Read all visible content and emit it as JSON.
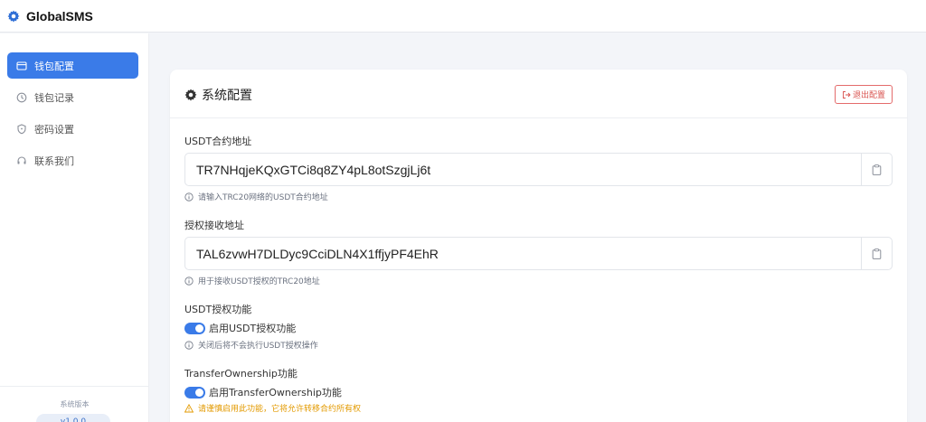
{
  "app": {
    "title": "GlobalSMS",
    "logo_icon": "gear-icon",
    "accent": "#3a7be8"
  },
  "sidebar": {
    "items": [
      {
        "label": "钱包配置",
        "icon": "wallet-icon",
        "active": true
      },
      {
        "label": "钱包记录",
        "icon": "clock-icon",
        "active": false
      },
      {
        "label": "密码设置",
        "icon": "shield-icon",
        "active": false
      },
      {
        "label": "联系我们",
        "icon": "headset-icon",
        "active": false
      }
    ],
    "version_label": "系统版本",
    "version_value": "v1.0.0"
  },
  "card": {
    "title": "系统配置",
    "title_icon": "gear-icon",
    "logout_label": "退出配置",
    "logout_color": "#d9534f",
    "fields": [
      {
        "label": "USDT合约地址",
        "value": "TR7NHqjeKQxGTCi8q8ZY4pL8otSzgjLj6t",
        "hint": "请输入TRC20网络的USDT合约地址"
      },
      {
        "label": "授权接收地址",
        "value": "TAL6zvwH7DLDyc9CciDLN4X1ffjyPF4EhR",
        "hint": "用于接收USDT授权的TRC20地址"
      }
    ],
    "toggles": [
      {
        "label": "USDT授权功能",
        "switch_label": "启用USDT授权功能",
        "enabled": true,
        "hint": "关闭后将不会执行USDT授权操作",
        "hint_type": "info"
      },
      {
        "label": "TransferOwnership功能",
        "switch_label": "启用TransferOwnership功能",
        "enabled": true,
        "hint": "请谨慎启用此功能，它将允许转移合约所有权",
        "hint_type": "warning",
        "warning_color": "#e39a00"
      }
    ]
  }
}
